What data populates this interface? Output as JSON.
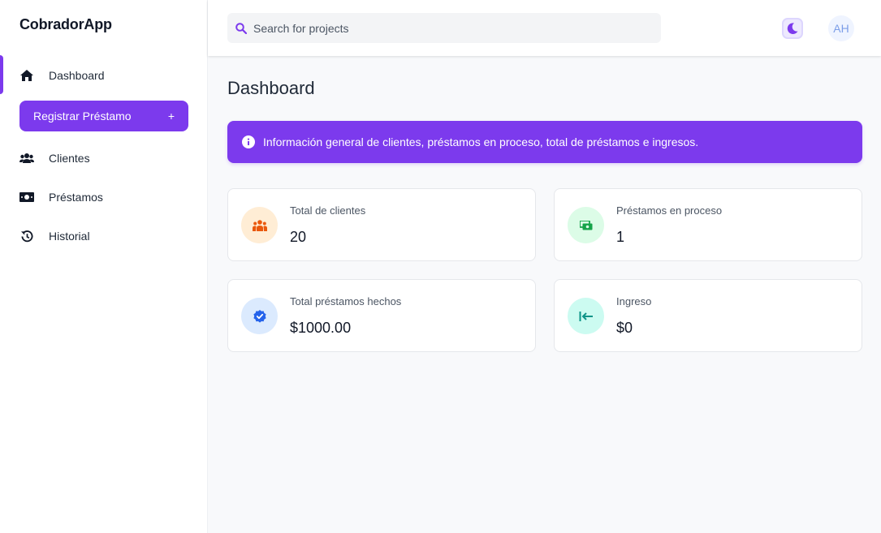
{
  "app": {
    "brand": "CobradorApp"
  },
  "sidebar": {
    "items": [
      {
        "label": "Dashboard",
        "icon": "home-icon"
      },
      {
        "label": "Clientes",
        "icon": "users-icon"
      },
      {
        "label": "Préstamos",
        "icon": "money-icon"
      },
      {
        "label": "Historial",
        "icon": "history-icon"
      }
    ],
    "register_button": {
      "label": "Registrar Préstamo",
      "icon": "plus-icon",
      "plus": "+"
    }
  },
  "header": {
    "search": {
      "placeholder": "Search for projects",
      "value": "",
      "icon": "search-icon"
    },
    "theme_toggle": {
      "icon": "moon-icon"
    },
    "avatar_initials": "AH"
  },
  "main": {
    "title": "Dashboard",
    "alert": {
      "icon": "info-icon",
      "text": "Información general de clientes, préstamos en proceso, total de préstamos e ingresos."
    },
    "cards": [
      {
        "label": "Total de clientes",
        "value": "20",
        "icon": "users-icon"
      },
      {
        "label": "Préstamos en proceso",
        "value": "1",
        "icon": "money-icon"
      },
      {
        "label": "Total préstamos hechos",
        "value": "$1000.00",
        "icon": "check-badge-icon"
      },
      {
        "label": "Ingreso",
        "value": "$0",
        "icon": "arrow-left-to-line-icon"
      }
    ]
  },
  "colors": {
    "accent": "#7c3aed",
    "card_orange_bg": "#ffedd5",
    "card_orange_fg": "#ea580c",
    "card_green_bg": "#dcfce7",
    "card_green_fg": "#16a34a",
    "card_blue_bg": "#dbeafe",
    "card_blue_fg": "#2563eb",
    "card_teal_bg": "#ccfbf1",
    "card_teal_fg": "#0d9488"
  }
}
